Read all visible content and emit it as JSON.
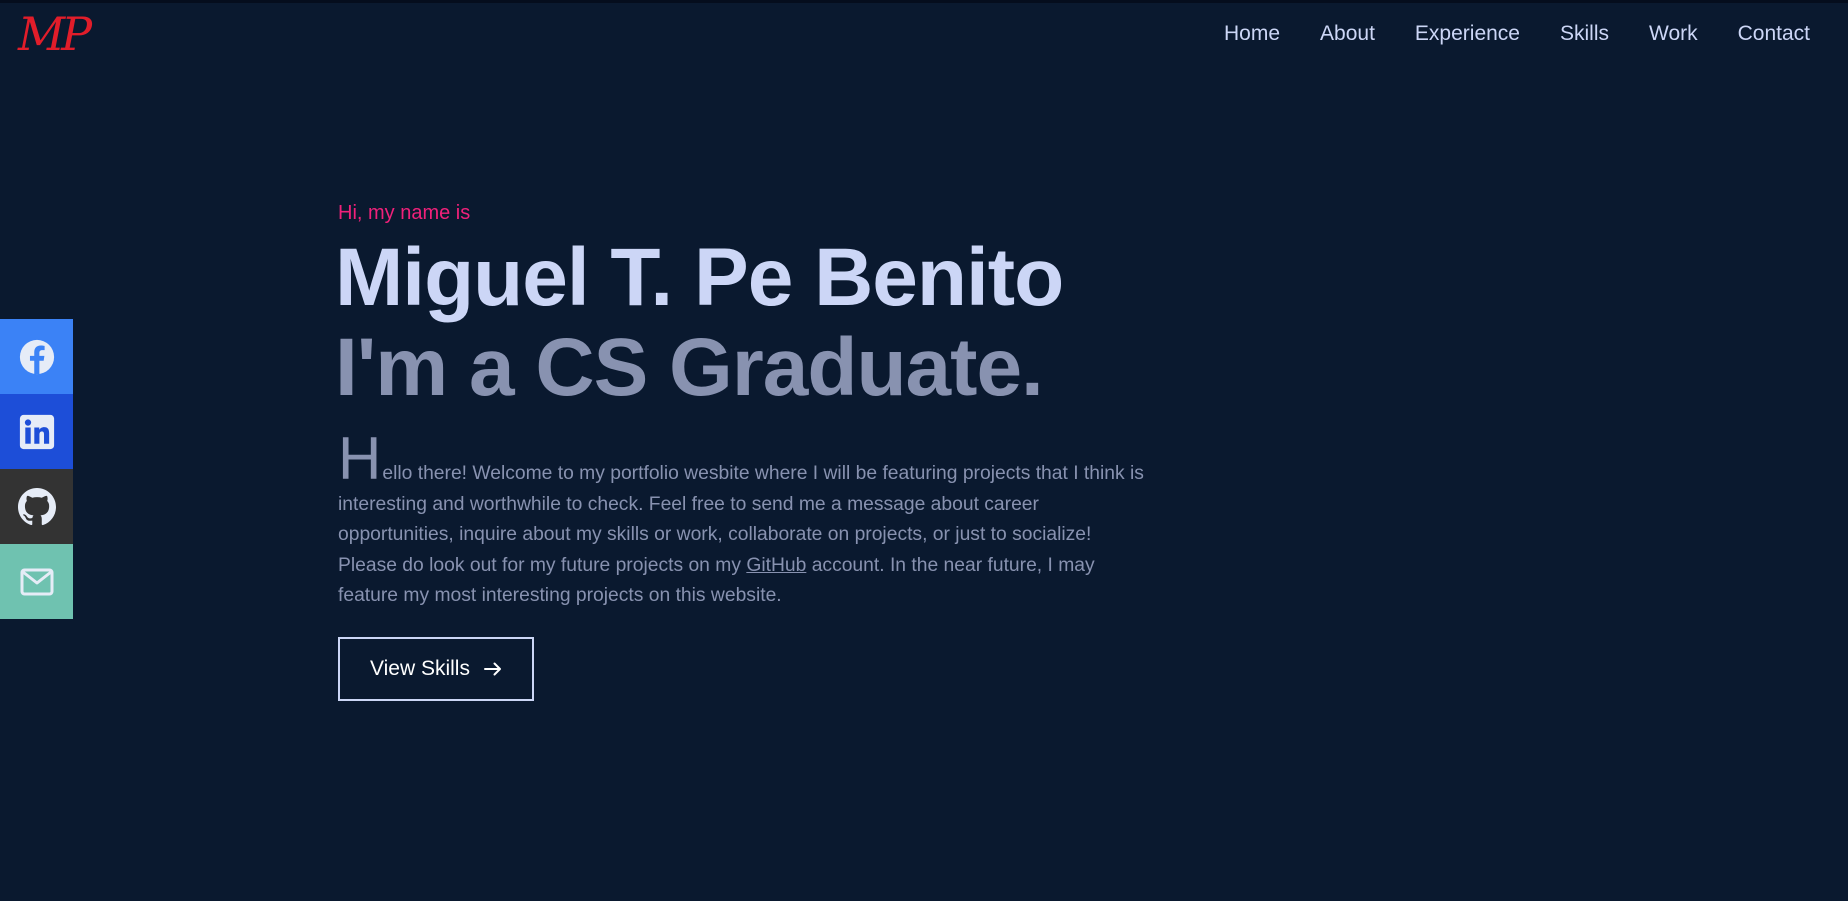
{
  "brand": {
    "logo_text": "MP"
  },
  "nav": {
    "items": [
      {
        "label": "Home"
      },
      {
        "label": "About"
      },
      {
        "label": "Experience"
      },
      {
        "label": "Skills"
      },
      {
        "label": "Work"
      },
      {
        "label": "Contact"
      }
    ]
  },
  "social": [
    {
      "name": "facebook",
      "icon": "facebook-icon",
      "color": "#3b82f6"
    },
    {
      "name": "linkedin",
      "icon": "linkedin-icon",
      "color": "#1d4ed8"
    },
    {
      "name": "github",
      "icon": "github-icon",
      "color": "#333333"
    },
    {
      "name": "email",
      "icon": "mail-icon",
      "color": "#6fc2b0"
    }
  ],
  "hero": {
    "greeting": "Hi, my name is",
    "name": "Miguel T. Pe Benito",
    "tagline": "I'm a CS Graduate.",
    "intro": {
      "dropcap": "H",
      "line1": "ello there! Welcome to my portfolio wesbite where I will be featuring projects that I think is",
      "line2": "interesting and worthwhile to check. Feel free to send me a message about career",
      "line3": "opportunities, inquire about my skills or work, collaborate on projects, or just to socialize!",
      "line4_before": "Please do look out for my future projects on my ",
      "link_text": "GitHub",
      "line4_after": " account. In the near future, I may",
      "line5": "feature my most interesting projects on this website."
    },
    "cta_label": "View Skills",
    "cta_icon": "arrow-right-icon"
  },
  "colors": {
    "background": "#0a192f",
    "accent_pink": "#f0217a",
    "logo_red": "#e11d2a",
    "heading_light": "#ccd6f6",
    "text_muted": "#8892b0"
  }
}
